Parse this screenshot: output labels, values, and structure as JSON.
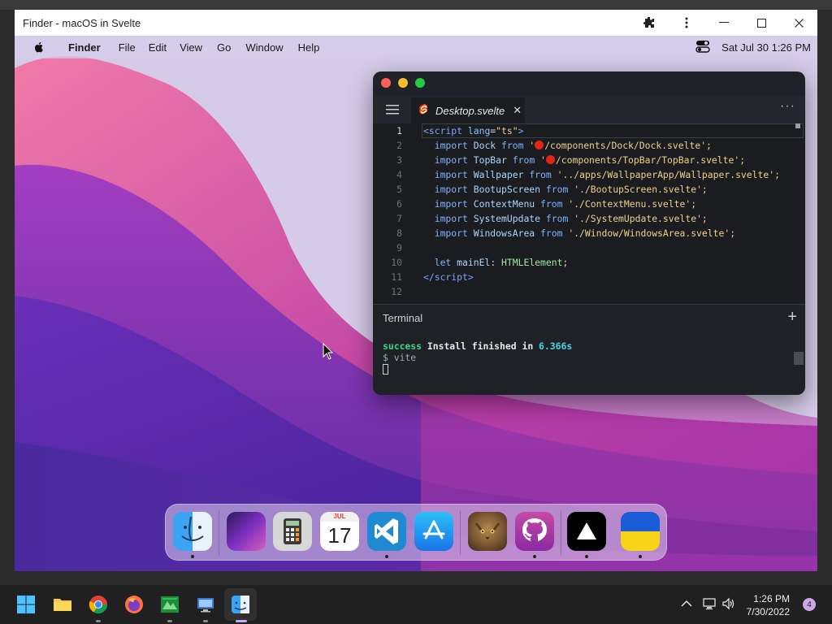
{
  "window": {
    "title": "Finder - macOS in Svelte"
  },
  "menubar": {
    "app_name": "Finder",
    "items": [
      "File",
      "Edit",
      "View",
      "Go",
      "Window",
      "Help"
    ],
    "datetime": "Sat Jul 30  1:26 PM"
  },
  "editor": {
    "tab_label": "Desktop.svelte",
    "lines": [
      {
        "n": "1"
      },
      {
        "n": "2"
      },
      {
        "n": "3"
      },
      {
        "n": "4"
      },
      {
        "n": "5"
      },
      {
        "n": "6"
      },
      {
        "n": "7"
      },
      {
        "n": "8"
      },
      {
        "n": "9"
      },
      {
        "n": "10"
      },
      {
        "n": "11"
      },
      {
        "n": "12"
      }
    ],
    "code": {
      "l1_tag_open": "<",
      "l1_tag": "script",
      "l1_attr": "lang",
      "l1_val": "\"ts\"",
      "l1_close": ">",
      "imports": [
        {
          "name": "Dock",
          "path_pre": "'",
          "path": "/components/Dock/Dock.svelte';",
          "emoji": true
        },
        {
          "name": "TopBar",
          "path_pre": "'",
          "path": "/components/TopBar/TopBar.svelte';",
          "emoji": true
        },
        {
          "name": "Wallpaper",
          "path_pre": "",
          "path": "'../apps/WallpaperApp/Wallpaper.svelte';",
          "emoji": false
        },
        {
          "name": "BootupScreen",
          "path_pre": "",
          "path": "'./BootupScreen.svelte';",
          "emoji": false
        },
        {
          "name": "ContextMenu",
          "path_pre": "",
          "path": "'./ContextMenu.svelte';",
          "emoji": false
        },
        {
          "name": "SystemUpdate",
          "path_pre": "",
          "path": "'./SystemUpdate.svelte';",
          "emoji": false
        },
        {
          "name": "WindowsArea",
          "path_pre": "",
          "path": "'./Window/WindowsArea.svelte';",
          "emoji": false
        }
      ],
      "kw_import": "import",
      "kw_from": "from",
      "kw_let": "let",
      "let_var": "mainEl",
      "let_colon": ": ",
      "let_type": "HTMLElement",
      "let_end": ";",
      "l11_close_open": "</",
      "l11_tag": "script",
      "l11_close": ">"
    }
  },
  "terminal": {
    "title": "Terminal",
    "success_word": "success",
    "install_text": " Install finished in ",
    "duration": "6.366s",
    "prompt": "$ vite"
  },
  "dock": {
    "apps": [
      "Finder",
      "Wallpapers",
      "Calculator",
      "Calendar",
      "VS Code",
      "App Store",
      "Cat",
      "GitHub",
      "Vercel",
      "Ukraine"
    ],
    "calendar_month": "JUL",
    "calendar_day": "17"
  },
  "taskbar": {
    "time": "1:26 PM",
    "date": "7/30/2022",
    "notification_count": "4"
  },
  "colors": {
    "close": "#fe5f57",
    "minimize": "#febc2e",
    "maximize": "#28c840",
    "editor_bg": "#1a1c20",
    "success": "#3ed28a"
  }
}
